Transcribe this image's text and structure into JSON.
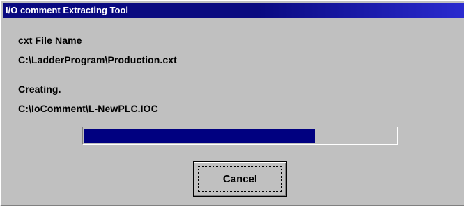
{
  "window": {
    "title": "I/O comment Extracting Tool"
  },
  "file_section": {
    "heading": "cxt File Name",
    "path": "C:\\LadderProgram\\Production.cxt"
  },
  "status_section": {
    "heading": "Creating.",
    "path": "C:\\IoComment\\L-NewPLC.IOC"
  },
  "progress": {
    "fraction": 0.74,
    "fill_color": "#000080"
  },
  "buttons": {
    "cancel_label": "Cancel"
  }
}
